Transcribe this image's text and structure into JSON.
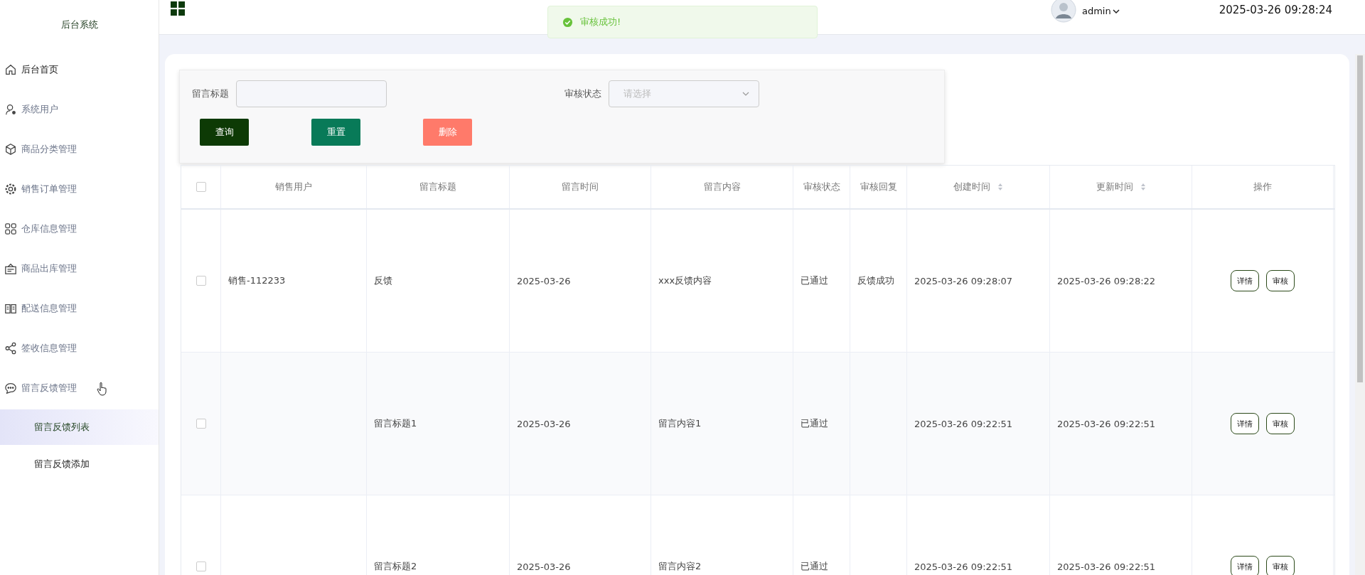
{
  "sidebar": {
    "title": "后台系统",
    "items": [
      {
        "kind": "link",
        "label": "后台首页"
      },
      {
        "kind": "submenu",
        "label": "系统用户"
      },
      {
        "kind": "submenu",
        "label": "商品分类管理"
      },
      {
        "kind": "submenu",
        "label": "销售订单管理"
      },
      {
        "kind": "submenu",
        "label": "仓库信息管理"
      },
      {
        "kind": "submenu",
        "label": "商品出库管理"
      },
      {
        "kind": "submenu",
        "label": "配送信息管理"
      },
      {
        "kind": "submenu",
        "label": "签收信息管理"
      },
      {
        "kind": "submenu",
        "label": "留言反馈管理",
        "children": [
          {
            "label": "留言反馈列表",
            "selected": true
          },
          {
            "label": "留言反馈添加",
            "selected": false
          }
        ]
      }
    ]
  },
  "topbar": {
    "user": "admin",
    "datetime": "2025-03-26 09:28:24"
  },
  "toast": {
    "kind": "success",
    "message": "审核成功!"
  },
  "filters": [
    {
      "label": "留言标题",
      "kind": "text"
    },
    {
      "label": "审核状态",
      "kind": "select",
      "placeholder": "请选择"
    }
  ],
  "actions": [
    {
      "label": "查询",
      "kind": "query"
    },
    {
      "label": "重置",
      "kind": "reset"
    },
    {
      "label": "删除",
      "kind": "delete"
    }
  ],
  "table": {
    "header_checked": false,
    "columns": [
      {
        "label": "销售用户",
        "sortable": false
      },
      {
        "label": "留言标题",
        "sortable": false
      },
      {
        "label": "留言时间",
        "sortable": false
      },
      {
        "label": "留言内容",
        "sortable": false
      },
      {
        "label": "审核状态",
        "sortable": false
      },
      {
        "label": "审核回复",
        "sortable": false
      },
      {
        "label": "创建时间",
        "sortable": true
      },
      {
        "label": "更新时间",
        "sortable": true
      },
      {
        "label": "操作",
        "sortable": false
      }
    ],
    "rows": [
      {
        "checked": false,
        "cells": [
          "销售-112233",
          "反馈",
          "2025-03-26",
          "xxx反馈内容",
          "已通过",
          "反馈成功",
          "2025-03-26 09:28:07",
          "2025-03-26 09:28:22"
        ],
        "buttons": [
          "详情",
          "审核"
        ]
      },
      {
        "checked": false,
        "cells": [
          "",
          "留言标题1",
          "2025-03-26",
          "留言内容1",
          "已通过",
          "",
          "2025-03-26 09:22:51",
          "2025-03-26 09:22:51"
        ],
        "buttons": [
          "详情",
          "审核"
        ]
      },
      {
        "checked": false,
        "cells": [
          "",
          "留言标题2",
          "2025-03-26",
          "留言内容2",
          "已通过",
          "",
          "2025-03-26 09:22:51",
          "2025-03-26 09:22:51"
        ],
        "buttons": [
          "详情",
          "审核"
        ]
      }
    ]
  }
}
